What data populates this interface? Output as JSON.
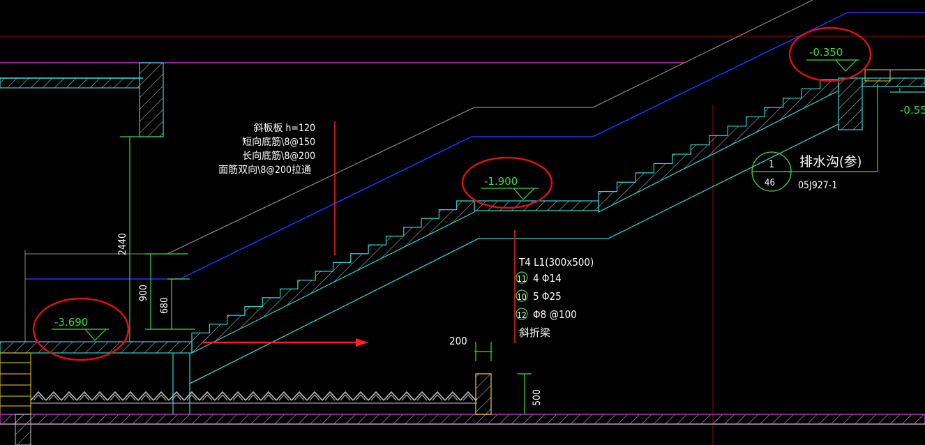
{
  "drawing": {
    "colors": {
      "background": "#000000",
      "concrete_outline": "#2fd6d6",
      "hatch": "#b8b8b8",
      "dimension": "#3fdc3f",
      "floor_line": "#c030c0",
      "blue_line": "#2433ff",
      "red_line": "#ff2020",
      "gray_line": "#8a8a8a",
      "yellow": "#f0d020",
      "highlight_circle": "#e01010"
    },
    "elevations": {
      "left": "-3.690",
      "middle": "-1.900",
      "top": "-0.350",
      "right": "-0.55"
    },
    "slab_note": {
      "line1": "斜板板 h=120",
      "line2": "短向底筋\\8@150",
      "line3": "长向底筋\\8@200",
      "line4": "面筋双向\\8@200拉通"
    },
    "beam_note": {
      "title": "T4 L1(300x500)",
      "rows": [
        {
          "tag": "11",
          "text": "4 Φ14"
        },
        {
          "tag": "10",
          "text": "5 Φ25"
        },
        {
          "tag": "12",
          "text": "Φ8 @100"
        }
      ],
      "footer": "斜折梁"
    },
    "dimensions": {
      "total_height": "2440",
      "d900": "900",
      "d680": "680",
      "d200": "200",
      "d500": "500"
    },
    "reference": {
      "bubble_top": "1",
      "bubble_bottom": "46",
      "label": "排水沟(参)",
      "std": "05J927-1"
    }
  }
}
